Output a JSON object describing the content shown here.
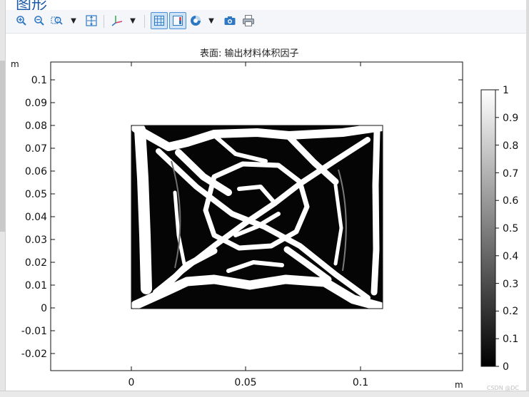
{
  "window": {
    "title": "图形"
  },
  "toolbar": {
    "buttons": [
      {
        "name": "zoom-in-icon",
        "label": ""
      },
      {
        "name": "zoom-out-icon",
        "label": ""
      },
      {
        "name": "zoom-box-icon",
        "label": ""
      },
      {
        "name": "zoom-extents-icon",
        "label": ""
      },
      {
        "name": "axis-orientation-icon",
        "label": ""
      },
      {
        "name": "grid-toggle-icon",
        "label": ""
      },
      {
        "name": "legend-toggle-icon",
        "label": ""
      },
      {
        "name": "color-scene-icon",
        "label": ""
      },
      {
        "name": "camera-icon",
        "label": ""
      },
      {
        "name": "print-icon",
        "label": ""
      }
    ]
  },
  "plot": {
    "title": "表面: 输出材料体积因子",
    "x_unit": "m",
    "y_unit": "m",
    "x_ticks": [
      "0",
      "0.05",
      "0.1"
    ],
    "y_ticks": [
      "0.1",
      "0.09",
      "0.08",
      "0.07",
      "0.06",
      "0.05",
      "0.04",
      "0.03",
      "0.02",
      "0.01",
      "0",
      "-0.01",
      "-0.02"
    ]
  },
  "colorbar": {
    "ticks": [
      "1",
      "0.9",
      "0.8",
      "0.7",
      "0.6",
      "0.5",
      "0.4",
      "0.3",
      "0.2",
      "0.1",
      "0"
    ],
    "colors": {
      "high": "#ffffff",
      "low": "#000000"
    }
  },
  "footer": {
    "credit": "CSDN @DC"
  },
  "colors": {
    "accent": "#1c5aa8",
    "toolbar_icon": "#2f78c4",
    "active_border": "#4a8fd8"
  }
}
